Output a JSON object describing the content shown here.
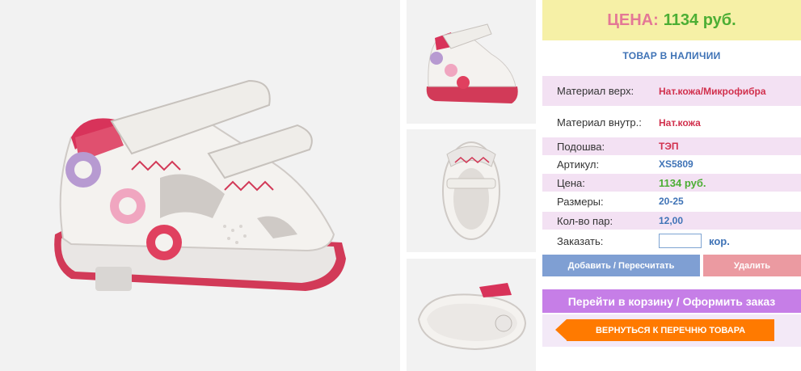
{
  "price_banner": {
    "label": "ЦЕНА:",
    "value": "1134 руб."
  },
  "stock_status": "ТОВАР В НАЛИЧИИ",
  "specs": [
    {
      "label": "Материал верх:",
      "value": "Нат.кожа/Микрофибра"
    },
    {
      "label": "Материал внутр.:",
      "value": "Нат.кожа"
    },
    {
      "label": "Подошва:",
      "value": "ТЭП"
    },
    {
      "label": "Артикул:",
      "value": "XS5809"
    },
    {
      "label": "Цена:",
      "value": "1134 руб."
    },
    {
      "label": "Размеры:",
      "value": "20-25"
    },
    {
      "label": "Кол-во пар:",
      "value": "12,00"
    }
  ],
  "order": {
    "label": "Заказать:",
    "unit": "кор.",
    "value": ""
  },
  "buttons": {
    "add": "Добавить / Пересчитать",
    "delete": "Удалить",
    "cart": "Перейти в корзину / Оформить заказ",
    "back": "ВЕРНУТЬСЯ К ПЕРЕЧНЮ ТОВАРА"
  },
  "colors": {
    "price_label": "#e47896",
    "price_value": "#4cae34",
    "accent_blue": "#3f73b6",
    "accent_red": "#d1304d",
    "cart_purple": "#c67ee7",
    "back_orange": "#ff7a00"
  }
}
